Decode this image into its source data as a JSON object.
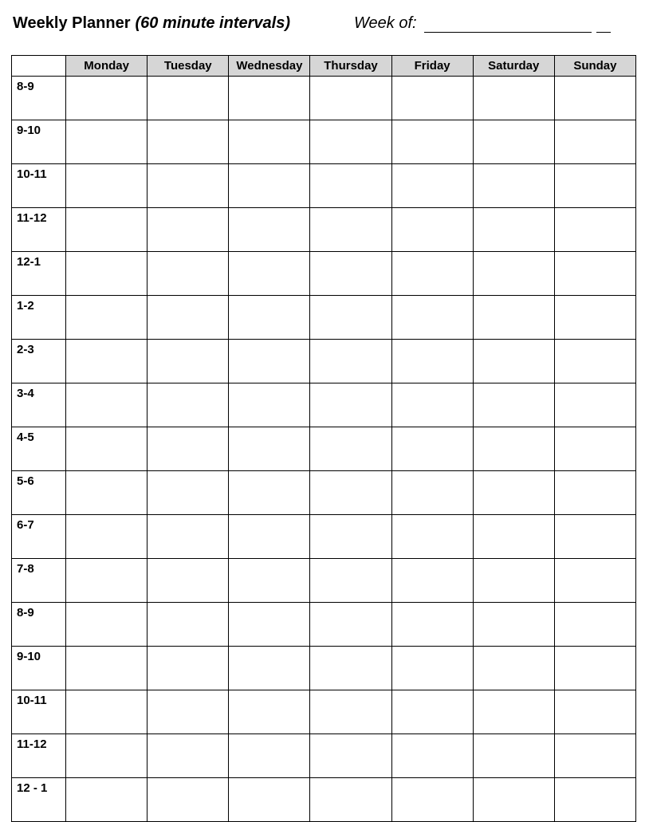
{
  "header": {
    "title": "Weekly Planner",
    "subtitle": "(60 minute intervals)",
    "weekof_label": "Week of:"
  },
  "table": {
    "days": [
      "Monday",
      "Tuesday",
      "Wednesday",
      "Thursday",
      "Friday",
      "Saturday",
      "Sunday"
    ],
    "times": [
      "8-9",
      "9-10",
      "10-11",
      "11-12",
      "12-1",
      "1-2",
      "2-3",
      "3-4",
      "4-5",
      "5-6",
      "6-7",
      "7-8",
      "8-9",
      "9-10",
      "10-11",
      "11-12",
      "12 - 1"
    ]
  }
}
